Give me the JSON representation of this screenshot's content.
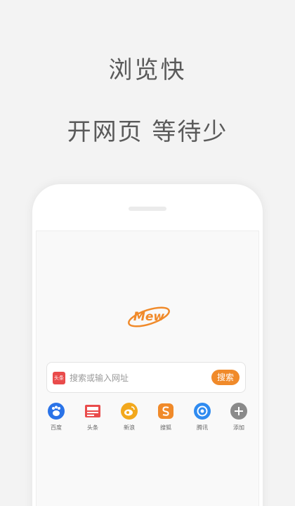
{
  "headline": {
    "line1": "浏览快",
    "line2": "开网页 等待少"
  },
  "logo": {
    "text": "Mew"
  },
  "search": {
    "brand_badge": "头条",
    "placeholder": "搜索或输入网址",
    "button": "搜索"
  },
  "shortcuts": [
    {
      "label": "百度",
      "icon": "paw-icon",
      "color": "#2a73e8"
    },
    {
      "label": "头条",
      "icon": "toutiao-icon",
      "color": "#e94b4b"
    },
    {
      "label": "新浪",
      "icon": "weibo-icon",
      "color": "#f2a81d"
    },
    {
      "label": "搜狐",
      "icon": "sohu-icon",
      "color": "#f08a2a"
    },
    {
      "label": "腾讯",
      "icon": "tencent-icon",
      "color": "#2f8bf0"
    },
    {
      "label": "添加",
      "icon": "plus-icon",
      "color": "#8a8a8a"
    }
  ],
  "colors": {
    "accent": "#f08a2a",
    "background": "#f3f3f3",
    "headline": "#5a5a5a"
  }
}
